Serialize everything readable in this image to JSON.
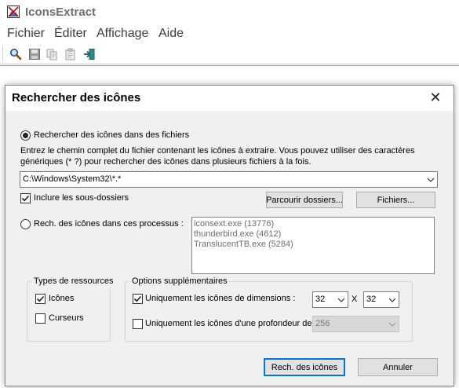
{
  "app": {
    "title": "IconsExtract"
  },
  "menu": {
    "items": [
      "Fichier",
      "Éditer",
      "Affichage",
      "Aide"
    ]
  },
  "toolbar": {
    "icons": [
      "search-icon",
      "save-icon",
      "copy-icon",
      "properties-icon",
      "exit-icon"
    ]
  },
  "dialog": {
    "title": "Rechercher des icônes",
    "close_label": "✕",
    "files_radio": {
      "label": "Rechercher des icônes dans des fichiers",
      "checked": true
    },
    "instructions": [
      "Entrez le chemin complet du fichier contenant les icônes à extraire. Vous pouvez utiliser des caractères",
      "génériques (* ?) pour rechercher des icônes dans plusieurs fichiers à la fois."
    ],
    "path_value": "C:\\Windows\\System32\\*.*",
    "include_subfolders": {
      "label": "Inclure les sous-dossiers",
      "checked": true
    },
    "browse_folders_label": "Parcourir dossiers...",
    "files_button_label": "Fichiers...",
    "process_radio": {
      "label": "Rech. des icônes dans ces processus :",
      "checked": false
    },
    "processes": [
      "iconsext.exe  (13776)",
      "thunderbird.exe  (4612)",
      "TranslucentTB.exe  (5284)"
    ],
    "resource_types": {
      "title": "Types de ressources",
      "icons": {
        "label": "Icônes",
        "checked": true
      },
      "cursors": {
        "label": "Curseurs",
        "checked": false
      }
    },
    "options": {
      "title": "Options supplémentaires",
      "dimensions": {
        "label": "Uniquement les icônes de dimensions :",
        "checked": true,
        "width": "32",
        "separator": "X",
        "height": "32"
      },
      "depth": {
        "label": "Uniquement les icônes d'une profondeur de",
        "checked": false,
        "value": "256"
      }
    },
    "search_button_label": "Rech. des icônes",
    "cancel_button_label": "Annuler"
  }
}
